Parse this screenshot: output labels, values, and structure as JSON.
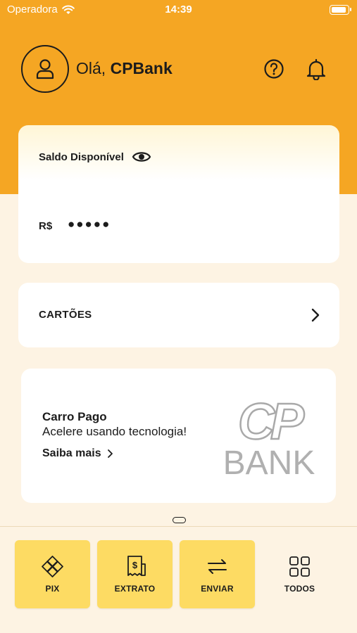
{
  "status_bar": {
    "carrier": "Operadora",
    "time": "14:39"
  },
  "header": {
    "greeting": "Olá,",
    "user_name": "CPBank"
  },
  "balance": {
    "label": "Saldo Disponível",
    "currency": "R$",
    "masked_value": "●●●●●"
  },
  "cards": {
    "label": "CARTÕES"
  },
  "promo": {
    "title": "Carro Pago",
    "subtitle": "Acelere usando tecnologia!",
    "link": "Saiba mais",
    "logo_top": "CP",
    "logo_bottom": "BANK"
  },
  "actions": [
    {
      "label": "PIX",
      "icon": "pix-icon"
    },
    {
      "label": "EXTRATO",
      "icon": "receipt-icon"
    },
    {
      "label": "ENVIAR",
      "icon": "transfer-arrows-icon"
    },
    {
      "label": "TODOS",
      "icon": "grid-icon"
    }
  ],
  "colors": {
    "header": "#f5a623",
    "action_button": "#fddb63",
    "background": "#fdf3e3"
  }
}
